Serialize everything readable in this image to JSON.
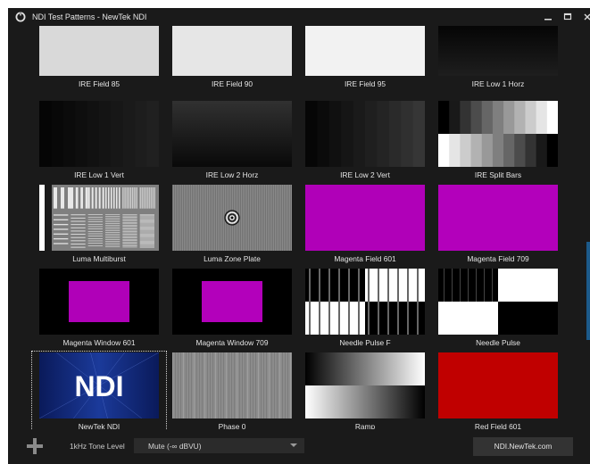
{
  "window": {
    "title": "NDI Test Patterns - NewTek NDI"
  },
  "titlebar_controls": {
    "minimize_icon": "minimize-icon",
    "maximize_icon": "maximize-icon",
    "close_icon": "close-icon"
  },
  "tiles": [
    {
      "label": "IRE Field 85",
      "pattern": "solid",
      "color": "#d9d9d9"
    },
    {
      "label": "IRE Field 90",
      "pattern": "solid",
      "color": "#e6e6e6"
    },
    {
      "label": "IRE Field 95",
      "pattern": "solid",
      "color": "#f2f2f2"
    },
    {
      "label": "IRE Low 1 Horz",
      "pattern": "hgrad",
      "stops": [
        "#050505",
        "#1e1e1e"
      ]
    },
    {
      "label": "IRE Low 1 Vert",
      "pattern": "vbars",
      "colors": [
        "#050505",
        "#080808",
        "#0b0b0b",
        "#0e0e0e",
        "#111111",
        "#141414",
        "#171717",
        "#1a1a1a",
        "#1d1d1d",
        "#202020"
      ]
    },
    {
      "label": "IRE Low 2 Horz",
      "pattern": "hgrad",
      "stops": [
        "#313131",
        "#090909"
      ]
    },
    {
      "label": "IRE Low 2 Vert",
      "pattern": "vbars",
      "colors": [
        "#060606",
        "#0b0b0b",
        "#101010",
        "#151515",
        "#1a1a1a",
        "#1f1f1f",
        "#242424",
        "#2a2a2a",
        "#303030",
        "#363636"
      ]
    },
    {
      "label": "IRE Split Bars",
      "pattern": "split",
      "top": [
        "#000000",
        "#191919",
        "#333333",
        "#4c4c4c",
        "#666666",
        "#7f7f7f",
        "#999999",
        "#b2b2b2",
        "#cccccc",
        "#e5e5e5",
        "#ffffff"
      ],
      "bottom": [
        "#ffffff",
        "#e5e5e5",
        "#cccccc",
        "#b2b2b2",
        "#999999",
        "#7f7f7f",
        "#666666",
        "#4c4c4c",
        "#333333",
        "#191919",
        "#000000"
      ]
    },
    {
      "label": "Luma Multiburst",
      "pattern": "multiburst"
    },
    {
      "label": "Luma Zone Plate",
      "pattern": "zoneplate"
    },
    {
      "label": "Magenta Field 601",
      "pattern": "solid",
      "color": "#b000b8"
    },
    {
      "label": "Magenta Field 709",
      "pattern": "solid",
      "color": "#b300bb"
    },
    {
      "label": "Magenta Window 601",
      "pattern": "window",
      "color": "#b000b8"
    },
    {
      "label": "Magenta Window 709",
      "pattern": "window",
      "color": "#b300bb"
    },
    {
      "label": "Needle Pulse F",
      "pattern": "needle"
    },
    {
      "label": "Needle Pulse",
      "pattern": "checker"
    },
    {
      "label": "NewTek NDI",
      "pattern": "ndi",
      "text": "NDI"
    },
    {
      "label": "Phase 0",
      "pattern": "phase"
    },
    {
      "label": "Ramp",
      "pattern": "ramp"
    },
    {
      "label": "Red Field 601",
      "pattern": "solid",
      "color": "#c00000"
    }
  ],
  "selected_tile": "NewTek NDI",
  "bottom_bar": {
    "add_icon": "plus-icon",
    "tone_label": "1kHz Tone Level",
    "tone_value": "Mute  (-∞ dBVU)",
    "link_label": "NDI.NewTek.com"
  }
}
